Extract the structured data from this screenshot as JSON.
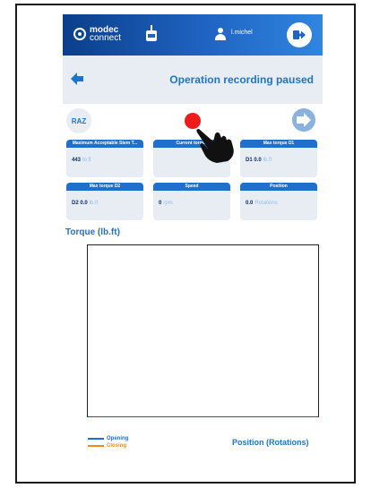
{
  "header": {
    "logo_line1": "modec",
    "logo_line2": "connect",
    "username": "l.michel",
    "icons": [
      "modec-logo-icon",
      "device-icon",
      "user-icon",
      "logout-icon"
    ]
  },
  "titlebar": {
    "title": "Operation recording paused",
    "back_icon": "arrow-left-icon"
  },
  "controls": {
    "raz_label": "RAZ",
    "record_color": "#f01a1a",
    "next_icon": "arrow-right-icon"
  },
  "cards": [
    {
      "title": "Maximum Acceptable Stem T...",
      "value": "443",
      "unit": "lb.ft"
    },
    {
      "title": "Current torque",
      "value": "",
      "unit": ""
    },
    {
      "title": "Max torque D1",
      "value": "D1 0.0",
      "unit": "lb.ft"
    },
    {
      "title": "Max torque D2",
      "value": "D2 0.0",
      "unit": "lb.ft"
    },
    {
      "title": "Speed",
      "value": "0",
      "unit": "rpm"
    },
    {
      "title": "Position",
      "value": "0.0",
      "unit": "Rotations"
    }
  ],
  "chart": {
    "title": "Torque (lb.ft)",
    "x_axis_title": "Position (Rotations)",
    "legend": [
      {
        "label": "Opening",
        "color": "#1f6fcf"
      },
      {
        "label": "Closing",
        "color": "#f08c1a"
      }
    ]
  },
  "colors": {
    "accent": "#1e74c9",
    "header_dark": "#0a3f8a",
    "card_header": "#1f6fcf"
  }
}
